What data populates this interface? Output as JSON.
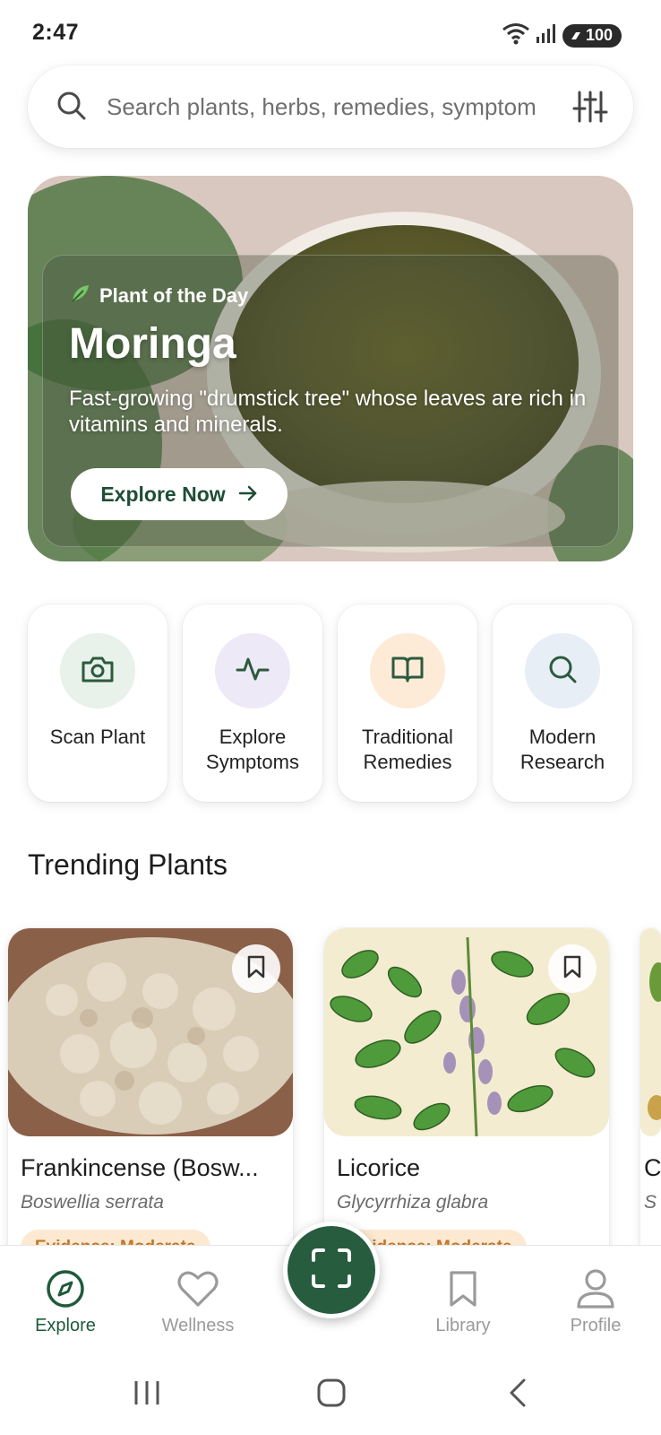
{
  "status_bar": {
    "time": "2:47",
    "battery": "100",
    "icons": [
      "wifi-icon",
      "signal-icon",
      "battery-icon"
    ]
  },
  "search": {
    "placeholder": "Search plants, herbs, remedies, symptom",
    "icon": "search-icon",
    "filter_icon": "sliders-icon"
  },
  "hero": {
    "tag": "Plant of the Day",
    "tag_icon": "leaf-icon",
    "title": "Moringa",
    "description": "Fast-growing \"drumstick tree\" whose leaves are rich in vitamins and minerals.",
    "button_label": "Explore Now"
  },
  "quick_actions": [
    {
      "label": "Scan Plant",
      "icon": "camera-icon",
      "bg": "#e8f1ea"
    },
    {
      "label": "Explore\nSymptoms",
      "icon": "pulse-icon",
      "bg": "#ede9f7"
    },
    {
      "label": "Traditional\nRemedies",
      "icon": "book-icon",
      "bg": "#fdebd8"
    },
    {
      "label": "Modern\nResearch",
      "icon": "search-icon",
      "bg": "#e8eef6"
    }
  ],
  "section": {
    "trending_title": "Trending Plants"
  },
  "trending": [
    {
      "name": "Frankincense (Bosw...",
      "scientific": "Boswellia serrata",
      "badge": "Evidence: Moderate"
    },
    {
      "name": "Licorice",
      "scientific": "Glycyrrhiza glabra",
      "badge": "Evidence: Moderate"
    },
    {
      "name": "C",
      "scientific": "S",
      "badge": ""
    }
  ],
  "bottom_nav": [
    {
      "label": "Explore",
      "icon": "compass-icon",
      "active": true
    },
    {
      "label": "Wellness",
      "icon": "heart-icon",
      "active": false
    },
    {
      "label": "Library",
      "icon": "bookmark-icon",
      "active": false
    },
    {
      "label": "Profile",
      "icon": "person-icon",
      "active": false
    }
  ],
  "colors": {
    "primary": "#275c3e",
    "badge_bg": "#fde9d2",
    "badge_text": "#c0762a"
  }
}
